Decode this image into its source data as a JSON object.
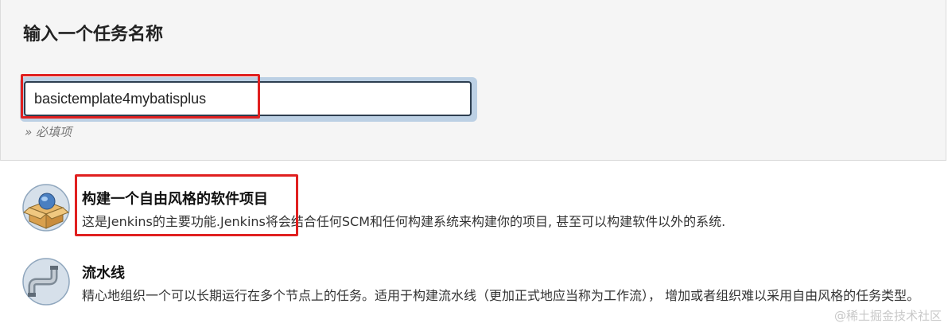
{
  "form": {
    "heading": "输入一个任务名称",
    "item_name_value": "basictemplate4mybatisplus",
    "required_hint": "» 必填项"
  },
  "job_types": [
    {
      "title": "构建一个自由风格的软件项目",
      "description": "这是Jenkins的主要功能.Jenkins将会结合任何SCM和任何构建系统来构建你的项目, 甚至可以构建软件以外的系统.",
      "icon": "freestyle-box-icon"
    },
    {
      "title": "流水线",
      "description": "精心地组织一个可以长期运行在多个节点上的任务。适用于构建流水线（更加正式地应当称为工作流）， 增加或者组织难以采用自由风格的任务类型。",
      "icon": "pipeline-pipe-icon"
    }
  ],
  "watermark": "@稀土掘金技术社区",
  "colors": {
    "highlight": "#e02020",
    "input_border": "#2d3e50",
    "input_focus_ring": "#bcd0e4"
  }
}
